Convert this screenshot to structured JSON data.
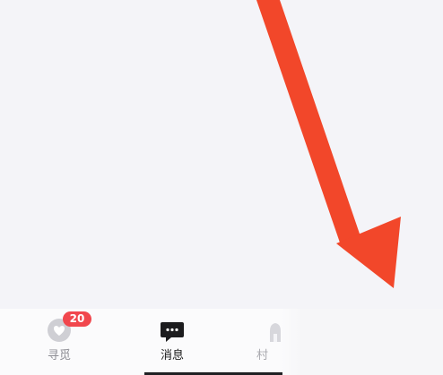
{
  "tabbar": {
    "tabs": [
      {
        "label": "寻觅",
        "badge": "20",
        "icon": "discover-heart-icon",
        "state": "inactive"
      },
      {
        "label": "消息",
        "icon": "chat-bubble-icon",
        "state": "active"
      },
      {
        "label": "村",
        "icon": "village-icon",
        "state": "inactive"
      }
    ]
  },
  "annotation": {
    "icon": "red-arrow-icon",
    "color": "#f2472a"
  },
  "colors": {
    "badge": "#f1474d",
    "active_text": "#1a1a1a",
    "inactive_text": "#8d8d94",
    "background": "#f4f4f8"
  }
}
